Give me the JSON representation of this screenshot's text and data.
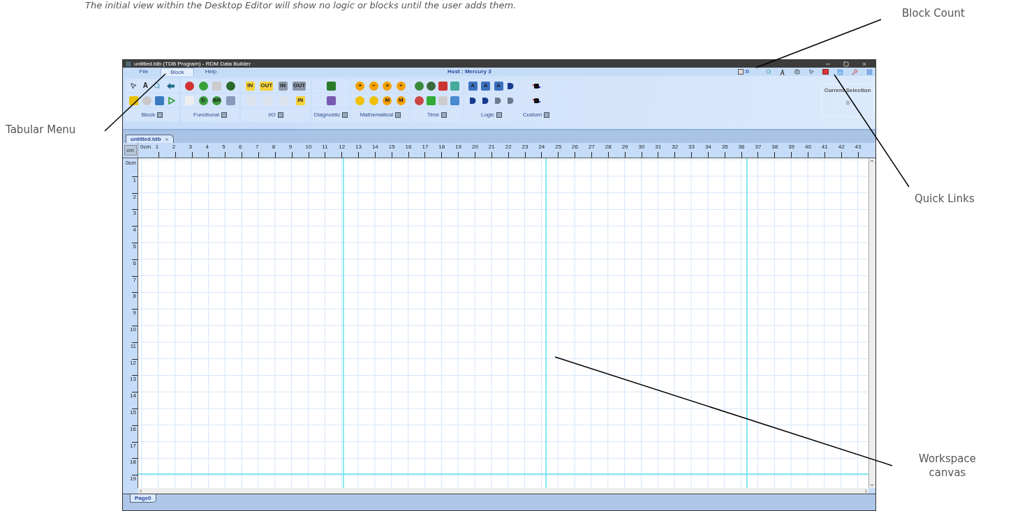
{
  "caption": "The initial view within the Desktop Editor will show no logic or blocks until the user adds them.",
  "annotations": [
    {
      "kind": "block_count",
      "label": "Block Count"
    },
    {
      "kind": "tabular_menu",
      "label": "Tabular Menu"
    },
    {
      "kind": "quick_links",
      "label": "Quick Links"
    },
    {
      "kind": "workspace",
      "label": "Workspace canvas"
    }
  ],
  "window": {
    "title": "untitled.tdb (TDB Program) - RDM Data Builder"
  },
  "menu_tabs": [
    {
      "label": "File",
      "selected": false
    },
    {
      "label": "Block",
      "selected": true
    },
    {
      "label": "Help",
      "selected": false
    }
  ],
  "host": "Host : Mercury 3",
  "block_count": ":0",
  "ribbon_groups": [
    {
      "label": "Block",
      "rows": [
        [
          {
            "kind": "pointer"
          },
          {
            "kind": "glyph",
            "text": "A"
          },
          {
            "kind": "magnifier"
          },
          {
            "kind": "back",
            "color": "#1e6b8a"
          }
        ],
        [
          {
            "kind": "tile",
            "color": "#e8c000"
          },
          {
            "kind": "ball",
            "color": "#c8c8c8"
          },
          {
            "kind": "tile",
            "color": "#3a7ac0"
          },
          {
            "kind": "play",
            "color": "#2aa02a"
          }
        ]
      ]
    },
    {
      "label": "Functional",
      "rows": [
        [
          {
            "kind": "ball",
            "color": "#d33030"
          },
          {
            "kind": "ball",
            "color": "#3aa03a"
          },
          {
            "kind": "tile",
            "color": "#cccccc"
          },
          {
            "kind": "ball",
            "color": "#2a6a2a"
          }
        ],
        [
          {
            "kind": "tile",
            "color": "#eeeeee"
          },
          {
            "kind": "ball",
            "color": "#3a9a3a",
            "text": "D"
          },
          {
            "kind": "ball",
            "color": "#3a9a3a",
            "text": "BR"
          },
          {
            "kind": "tile",
            "color": "#8899bb"
          }
        ]
      ]
    },
    {
      "label": "I/O",
      "rows": [
        [
          {
            "kind": "tile",
            "color": "#f5d23a",
            "text": "IN"
          },
          {
            "kind": "tile",
            "color": "#f5d23a",
            "text": "OUT"
          },
          {
            "kind": "tile",
            "color": "#8a96a8",
            "text": "IN"
          },
          {
            "kind": "tile",
            "color": "#8a96a8",
            "text": "OUT"
          }
        ],
        [
          {
            "kind": "tile",
            "color": "#dde3ea"
          },
          {
            "kind": "tile",
            "color": "#dde3ea"
          },
          {
            "kind": "tile",
            "color": "#dde3ea"
          },
          {
            "kind": "tile",
            "color": "#f5d23a",
            "text": "IN"
          }
        ]
      ]
    },
    {
      "label": "Diagnostic",
      "rows": [
        [
          {
            "kind": "tile",
            "color": "#2a7a2a"
          }
        ],
        [
          {
            "kind": "tile",
            "color": "#7a5ab0"
          }
        ]
      ]
    },
    {
      "label": "Mathematical",
      "rows": [
        [
          {
            "kind": "ball",
            "color": "#f5a000",
            "text": "+"
          },
          {
            "kind": "ball",
            "color": "#f5a000",
            "text": "−"
          },
          {
            "kind": "ball",
            "color": "#f5a000",
            "text": "×"
          },
          {
            "kind": "ball",
            "color": "#f5a000",
            "text": "÷"
          }
        ],
        [
          {
            "kind": "ball",
            "color": "#f0c000"
          },
          {
            "kind": "ball",
            "color": "#f0c000"
          },
          {
            "kind": "ball",
            "color": "#f5a000",
            "text": "M"
          },
          {
            "kind": "ball",
            "color": "#f5a000",
            "text": "M"
          }
        ]
      ]
    },
    {
      "label": "Time",
      "rows": [
        [
          {
            "kind": "ball",
            "color": "#3a8a3a"
          },
          {
            "kind": "ball",
            "color": "#3a6a3a"
          },
          {
            "kind": "tile",
            "color": "#cc3333"
          },
          {
            "kind": "tile",
            "color": "#44aa99"
          }
        ],
        [
          {
            "kind": "ball",
            "color": "#cc4444"
          },
          {
            "kind": "tile",
            "color": "#33aa33"
          },
          {
            "kind": "tile",
            "color": "#cccccc"
          },
          {
            "kind": "tile",
            "color": "#4a8ad0"
          }
        ]
      ]
    },
    {
      "label": "Logic",
      "rows": [
        [
          {
            "kind": "tile",
            "color": "#3a70c0",
            "text": "A"
          },
          {
            "kind": "tile",
            "color": "#3a70c0",
            "text": "A"
          },
          {
            "kind": "tile",
            "color": "#3a70c0",
            "text": "A"
          },
          {
            "kind": "gate",
            "color": "#1a3a90"
          }
        ],
        [
          {
            "kind": "gate",
            "color": "#1a3a90"
          },
          {
            "kind": "gate",
            "color": "#1a3a90"
          },
          {
            "kind": "gate",
            "color": "#6a7a90"
          },
          {
            "kind": "gate",
            "color": "#6a7a90"
          }
        ]
      ]
    },
    {
      "label": "Custom",
      "rows": [
        [
          {
            "kind": "chip",
            "color": "#111111"
          }
        ],
        [
          {
            "kind": "chip",
            "color": "#111111"
          }
        ]
      ]
    }
  ],
  "current_selection": {
    "title": "Current Selection"
  },
  "document_tabs": [
    {
      "label": "untitled.tdb",
      "selected": true
    }
  ],
  "ruler": {
    "unit_button": "cm",
    "x_labels": [
      "0cm",
      "1",
      "2",
      "3",
      "4",
      "5",
      "6",
      "7",
      "8",
      "9",
      "10",
      "11",
      "12",
      "13",
      "14",
      "15",
      "16",
      "17",
      "18",
      "19",
      "20",
      "21",
      "22",
      "23",
      "24",
      "25",
      "26",
      "27",
      "28",
      "29",
      "30",
      "31",
      "32",
      "33",
      "34",
      "35",
      "36",
      "37",
      "38",
      "39",
      "40",
      "41",
      "42",
      "43"
    ],
    "y_labels": [
      "0cm",
      "1",
      "2",
      "3",
      "4",
      "5",
      "6",
      "7",
      "8",
      "9",
      "10",
      "11",
      "12",
      "13",
      "14",
      "15",
      "16",
      "17",
      "18",
      "19"
    ]
  },
  "page_tabs": [
    {
      "label": "Page0",
      "selected": true
    }
  ]
}
